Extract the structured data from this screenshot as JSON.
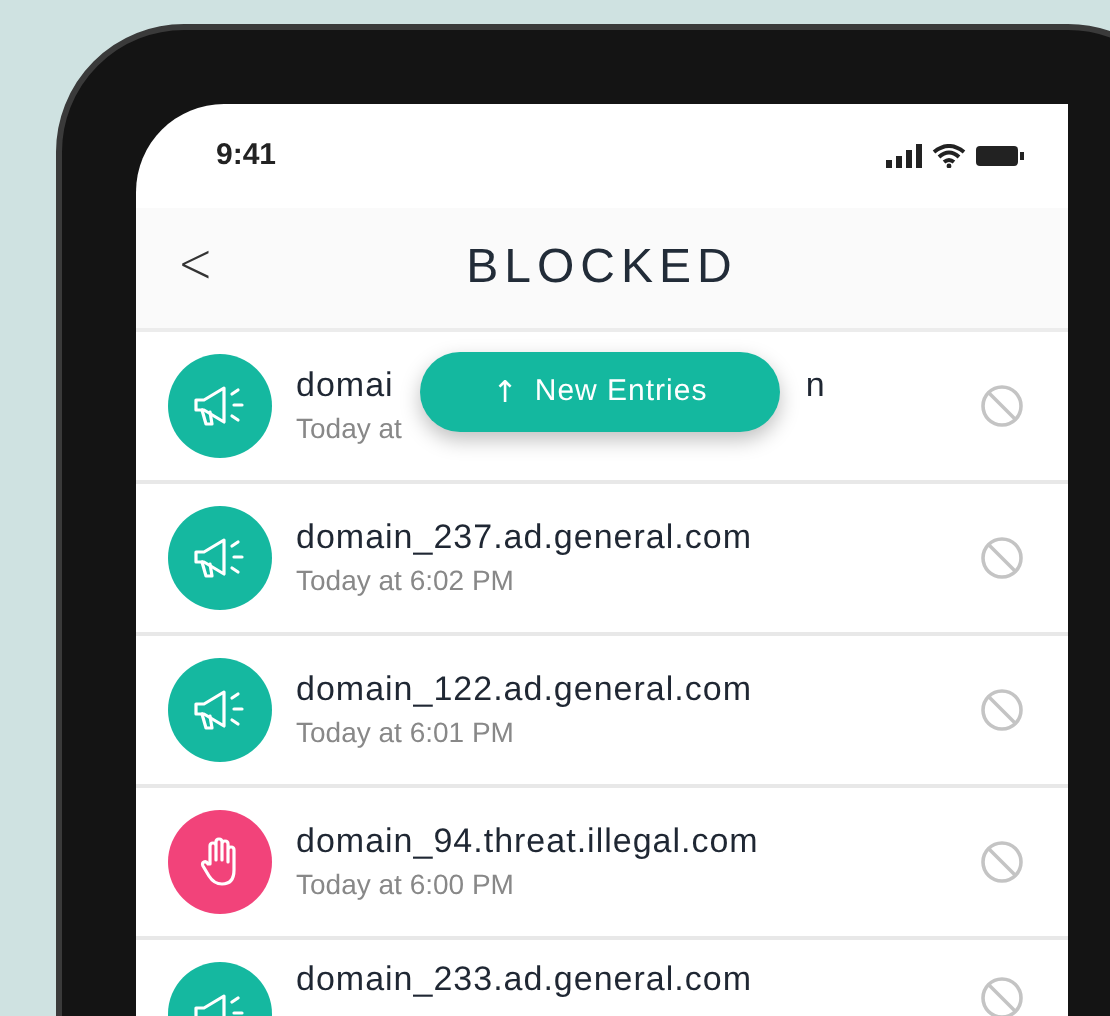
{
  "status_bar": {
    "time": "9:41"
  },
  "header": {
    "back": "<",
    "title": "BLOCKED"
  },
  "new_entries_button": {
    "arrow": "↑",
    "label": "New Entries"
  },
  "entries": [
    {
      "kind": "ad",
      "name_parts": [
        "domai",
        "n"
      ],
      "time": "Today at"
    },
    {
      "kind": "ad",
      "name": "domain_237.ad.general.com",
      "time": "Today at 6:02 PM"
    },
    {
      "kind": "ad",
      "name": "domain_122.ad.general.com",
      "time": "Today at 6:01 PM"
    },
    {
      "kind": "threat",
      "name": "domain_94.threat.illegal.com",
      "time": "Today at 6:00 PM"
    },
    {
      "kind": "ad",
      "name": "domain_233.ad.general.com"
    }
  ]
}
